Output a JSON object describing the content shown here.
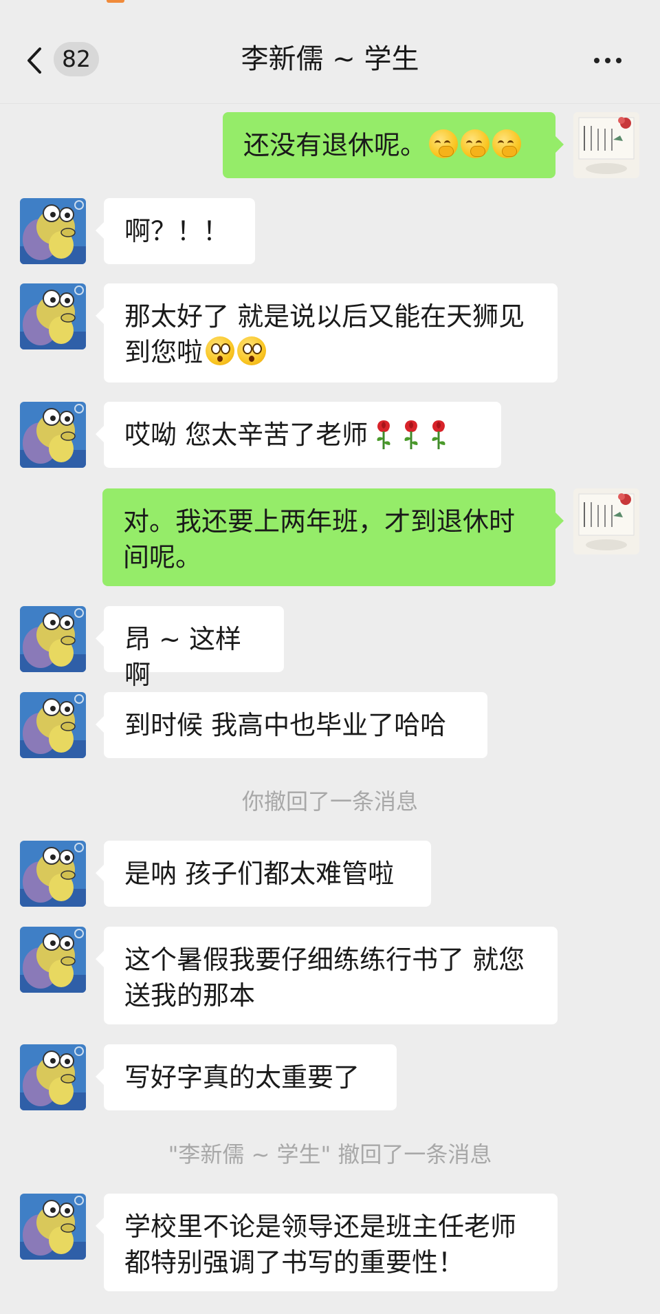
{
  "nav": {
    "unread_count": "82",
    "title": "李新儒 ~ 学生"
  },
  "colors": {
    "background": "#ededed",
    "outgoing_bubble": "#95ec69",
    "incoming_bubble": "#ffffff",
    "system_text": "#a8a8a8"
  },
  "messages": [
    {
      "side": "out",
      "text": "还没有退休呢。",
      "emoji": "facepalm-thinking-emoji x3"
    },
    {
      "side": "in",
      "text": "啊？！！"
    },
    {
      "side": "in",
      "text": "那太好了 就是说以后又能在天狮见到您啦",
      "emoji": "surprised-crying-emoji x2"
    },
    {
      "side": "in",
      "text": "哎呦 您太辛苦了老师",
      "emoji": "rose-emoji x3"
    },
    {
      "side": "out",
      "text": "对。我还要上两年班，才到退休时间呢。"
    },
    {
      "side": "in",
      "text": "昂 ~ 这样啊"
    },
    {
      "side": "in",
      "text": "到时候 我高中也毕业了哈哈"
    },
    {
      "side": "system",
      "text": "你撤回了一条消息"
    },
    {
      "side": "in",
      "text": "是呐 孩子们都太难管啦"
    },
    {
      "side": "in",
      "text": "这个暑假我要仔细练练行书了 就您送我的那本"
    },
    {
      "side": "in",
      "text": "写好字真的太重要了"
    },
    {
      "side": "system",
      "text": "\"李新儒 ~ 学生\" 撤回了一条消息"
    },
    {
      "side": "in",
      "text": "学校里不论是领导还是班主任老师都特别强调了书写的重要性！"
    }
  ],
  "line_breaks": {
    "m2_line1": "那太好了 就是说以后又能在天狮见",
    "m2_line2": "到您啦",
    "m4_line1": "对。我还要上两年班，才到退休时",
    "m4_line2": "间呢。",
    "m9_line1": "这个暑假我要仔细练练行书了 就您",
    "m9_line2": "送我的那本",
    "m12_line1": "学校里不论是领导还是班主任老师",
    "m12_line2": "都特别强调了书写的重要性！"
  }
}
